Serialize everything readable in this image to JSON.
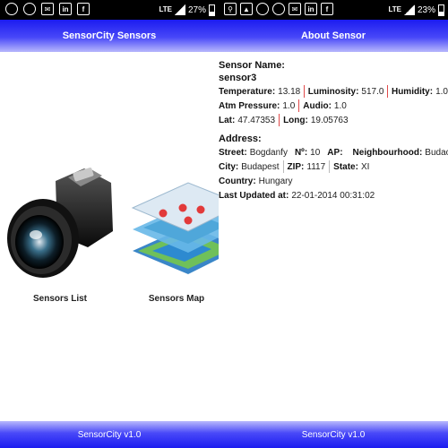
{
  "left": {
    "status": {
      "lte": "LTE",
      "battery": "27%"
    },
    "title": "SensorCity Sensors",
    "menu": [
      {
        "label": "Sensors List",
        "icon": "camera-icon"
      },
      {
        "label": "Sensors Map",
        "icon": "map-layers-icon"
      }
    ],
    "footer": "SensorCity v1.0"
  },
  "right": {
    "status": {
      "lte": "LTE",
      "battery": "23%"
    },
    "title": "About Sensor",
    "sensor_name_label": "Sensor Name:",
    "sensor_name": "sensor3",
    "temperature_label": "Temperature:",
    "temperature": "13.18",
    "luminosity_label": "Luminosity:",
    "luminosity": "517.0",
    "humidity_label": "Humidity:",
    "humidity": "1.0",
    "atm_label": "Atm Pressure:",
    "atm": "1.0",
    "audio_label": "Audio:",
    "audio": "1.0",
    "lat_label": "Lat:",
    "lat": "47.47353",
    "long_label": "Long:",
    "long": "19.05763",
    "address_label": "Address:",
    "street_label": "Street:",
    "street": "Bogdanfy",
    "no_label": "Nº:",
    "no": "10",
    "ap_label": "AP:",
    "neighbourhood_label": "Neighbourhood:",
    "neighbourhood": "Budaoes",
    "city_label": "City:",
    "city": "Budapest",
    "zip_label": "ZIP:",
    "zip": "1117",
    "state_label": "State:",
    "state": "XI",
    "country_label": "Country:",
    "country": "Hungary",
    "updated_label": "Last Updated at:",
    "updated": "22-01-2014 00:31:02",
    "footer": "SensorCity v1.0"
  },
  "colors": {
    "accent": "#1c1cf0",
    "accent_light": "#b8b8fc",
    "separator": "#e04a4a"
  }
}
